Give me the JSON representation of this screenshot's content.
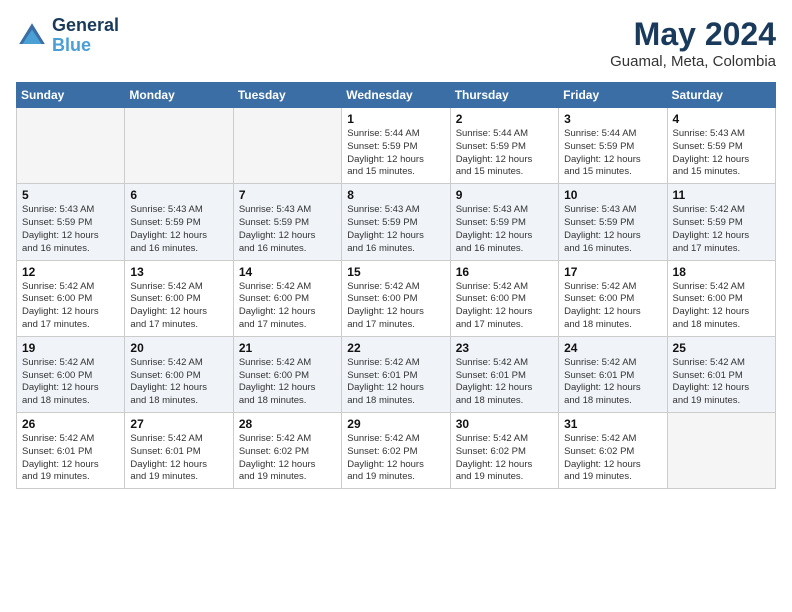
{
  "header": {
    "logo_line1": "General",
    "logo_line2": "Blue",
    "main_title": "May 2024",
    "subtitle": "Guamal, Meta, Colombia"
  },
  "days_of_week": [
    "Sunday",
    "Monday",
    "Tuesday",
    "Wednesday",
    "Thursday",
    "Friday",
    "Saturday"
  ],
  "weeks": [
    [
      {
        "day": "",
        "info": ""
      },
      {
        "day": "",
        "info": ""
      },
      {
        "day": "",
        "info": ""
      },
      {
        "day": "1",
        "info": "Sunrise: 5:44 AM\nSunset: 5:59 PM\nDaylight: 12 hours\nand 15 minutes."
      },
      {
        "day": "2",
        "info": "Sunrise: 5:44 AM\nSunset: 5:59 PM\nDaylight: 12 hours\nand 15 minutes."
      },
      {
        "day": "3",
        "info": "Sunrise: 5:44 AM\nSunset: 5:59 PM\nDaylight: 12 hours\nand 15 minutes."
      },
      {
        "day": "4",
        "info": "Sunrise: 5:43 AM\nSunset: 5:59 PM\nDaylight: 12 hours\nand 15 minutes."
      }
    ],
    [
      {
        "day": "5",
        "info": "Sunrise: 5:43 AM\nSunset: 5:59 PM\nDaylight: 12 hours\nand 16 minutes."
      },
      {
        "day": "6",
        "info": "Sunrise: 5:43 AM\nSunset: 5:59 PM\nDaylight: 12 hours\nand 16 minutes."
      },
      {
        "day": "7",
        "info": "Sunrise: 5:43 AM\nSunset: 5:59 PM\nDaylight: 12 hours\nand 16 minutes."
      },
      {
        "day": "8",
        "info": "Sunrise: 5:43 AM\nSunset: 5:59 PM\nDaylight: 12 hours\nand 16 minutes."
      },
      {
        "day": "9",
        "info": "Sunrise: 5:43 AM\nSunset: 5:59 PM\nDaylight: 12 hours\nand 16 minutes."
      },
      {
        "day": "10",
        "info": "Sunrise: 5:43 AM\nSunset: 5:59 PM\nDaylight: 12 hours\nand 16 minutes."
      },
      {
        "day": "11",
        "info": "Sunrise: 5:42 AM\nSunset: 5:59 PM\nDaylight: 12 hours\nand 17 minutes."
      }
    ],
    [
      {
        "day": "12",
        "info": "Sunrise: 5:42 AM\nSunset: 6:00 PM\nDaylight: 12 hours\nand 17 minutes."
      },
      {
        "day": "13",
        "info": "Sunrise: 5:42 AM\nSunset: 6:00 PM\nDaylight: 12 hours\nand 17 minutes."
      },
      {
        "day": "14",
        "info": "Sunrise: 5:42 AM\nSunset: 6:00 PM\nDaylight: 12 hours\nand 17 minutes."
      },
      {
        "day": "15",
        "info": "Sunrise: 5:42 AM\nSunset: 6:00 PM\nDaylight: 12 hours\nand 17 minutes."
      },
      {
        "day": "16",
        "info": "Sunrise: 5:42 AM\nSunset: 6:00 PM\nDaylight: 12 hours\nand 17 minutes."
      },
      {
        "day": "17",
        "info": "Sunrise: 5:42 AM\nSunset: 6:00 PM\nDaylight: 12 hours\nand 18 minutes."
      },
      {
        "day": "18",
        "info": "Sunrise: 5:42 AM\nSunset: 6:00 PM\nDaylight: 12 hours\nand 18 minutes."
      }
    ],
    [
      {
        "day": "19",
        "info": "Sunrise: 5:42 AM\nSunset: 6:00 PM\nDaylight: 12 hours\nand 18 minutes."
      },
      {
        "day": "20",
        "info": "Sunrise: 5:42 AM\nSunset: 6:00 PM\nDaylight: 12 hours\nand 18 minutes."
      },
      {
        "day": "21",
        "info": "Sunrise: 5:42 AM\nSunset: 6:00 PM\nDaylight: 12 hours\nand 18 minutes."
      },
      {
        "day": "22",
        "info": "Sunrise: 5:42 AM\nSunset: 6:01 PM\nDaylight: 12 hours\nand 18 minutes."
      },
      {
        "day": "23",
        "info": "Sunrise: 5:42 AM\nSunset: 6:01 PM\nDaylight: 12 hours\nand 18 minutes."
      },
      {
        "day": "24",
        "info": "Sunrise: 5:42 AM\nSunset: 6:01 PM\nDaylight: 12 hours\nand 18 minutes."
      },
      {
        "day": "25",
        "info": "Sunrise: 5:42 AM\nSunset: 6:01 PM\nDaylight: 12 hours\nand 19 minutes."
      }
    ],
    [
      {
        "day": "26",
        "info": "Sunrise: 5:42 AM\nSunset: 6:01 PM\nDaylight: 12 hours\nand 19 minutes."
      },
      {
        "day": "27",
        "info": "Sunrise: 5:42 AM\nSunset: 6:01 PM\nDaylight: 12 hours\nand 19 minutes."
      },
      {
        "day": "28",
        "info": "Sunrise: 5:42 AM\nSunset: 6:02 PM\nDaylight: 12 hours\nand 19 minutes."
      },
      {
        "day": "29",
        "info": "Sunrise: 5:42 AM\nSunset: 6:02 PM\nDaylight: 12 hours\nand 19 minutes."
      },
      {
        "day": "30",
        "info": "Sunrise: 5:42 AM\nSunset: 6:02 PM\nDaylight: 12 hours\nand 19 minutes."
      },
      {
        "day": "31",
        "info": "Sunrise: 5:42 AM\nSunset: 6:02 PM\nDaylight: 12 hours\nand 19 minutes."
      },
      {
        "day": "",
        "info": ""
      }
    ]
  ]
}
